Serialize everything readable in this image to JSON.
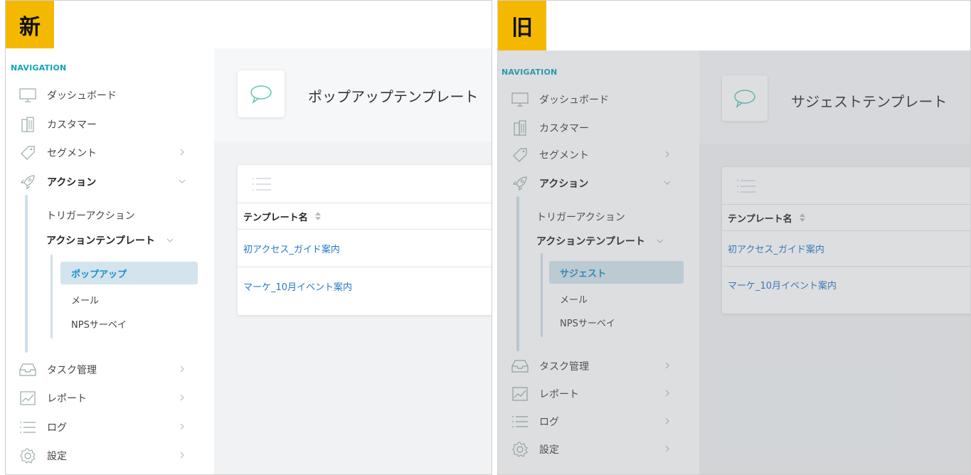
{
  "new": {
    "tag": "新",
    "nav_title": "NAVIGATION",
    "nav_items": [
      {
        "label": "ダッシュボード"
      },
      {
        "label": "カスタマー"
      },
      {
        "label": "セグメント"
      },
      {
        "label": "アクション"
      },
      {
        "label": "タスク管理"
      },
      {
        "label": "レポート"
      },
      {
        "label": "ログ"
      },
      {
        "label": "設定"
      }
    ],
    "action_sub": [
      "トリガーアクション",
      "アクションテンプレート"
    ],
    "template_sub": [
      "ポップアップ",
      "メール",
      "NPSサーベイ"
    ],
    "page_title": "ポップアップテンプレート",
    "table": {
      "column": "テンプレート名",
      "rows": [
        "初アクセス_ガイド案内",
        "マーケ_10月イベント案内"
      ]
    }
  },
  "old": {
    "tag": "旧",
    "nav_title": "NAVIGATION",
    "nav_items": [
      {
        "label": "ダッシュボード"
      },
      {
        "label": "カスタマー"
      },
      {
        "label": "セグメント"
      },
      {
        "label": "アクション"
      },
      {
        "label": "タスク管理"
      },
      {
        "label": "レポート"
      },
      {
        "label": "ログ"
      },
      {
        "label": "設定"
      }
    ],
    "action_sub": [
      "トリガーアクション",
      "アクションテンプレート"
    ],
    "template_sub": [
      "サジェスト",
      "メール",
      "NPSサーベイ"
    ],
    "page_title": "サジェストテンプレート",
    "table": {
      "column": "テンプレート名",
      "rows": [
        "初アクセス_ガイド案内",
        "マーケ_10月イベント案内"
      ]
    }
  },
  "colors": {
    "accent": "#12a3b8",
    "tag": "#f5b800",
    "link": "#2478c8",
    "active_bg": "#d3e4ec"
  },
  "icons": [
    "monitor-icon",
    "building-icon",
    "tag-icon",
    "rocket-icon",
    "inbox-icon",
    "chart-icon",
    "list-icon",
    "gear-icon",
    "chat-bubble-icon",
    "chevron-right-icon",
    "chevron-down-icon",
    "sort-icon"
  ]
}
